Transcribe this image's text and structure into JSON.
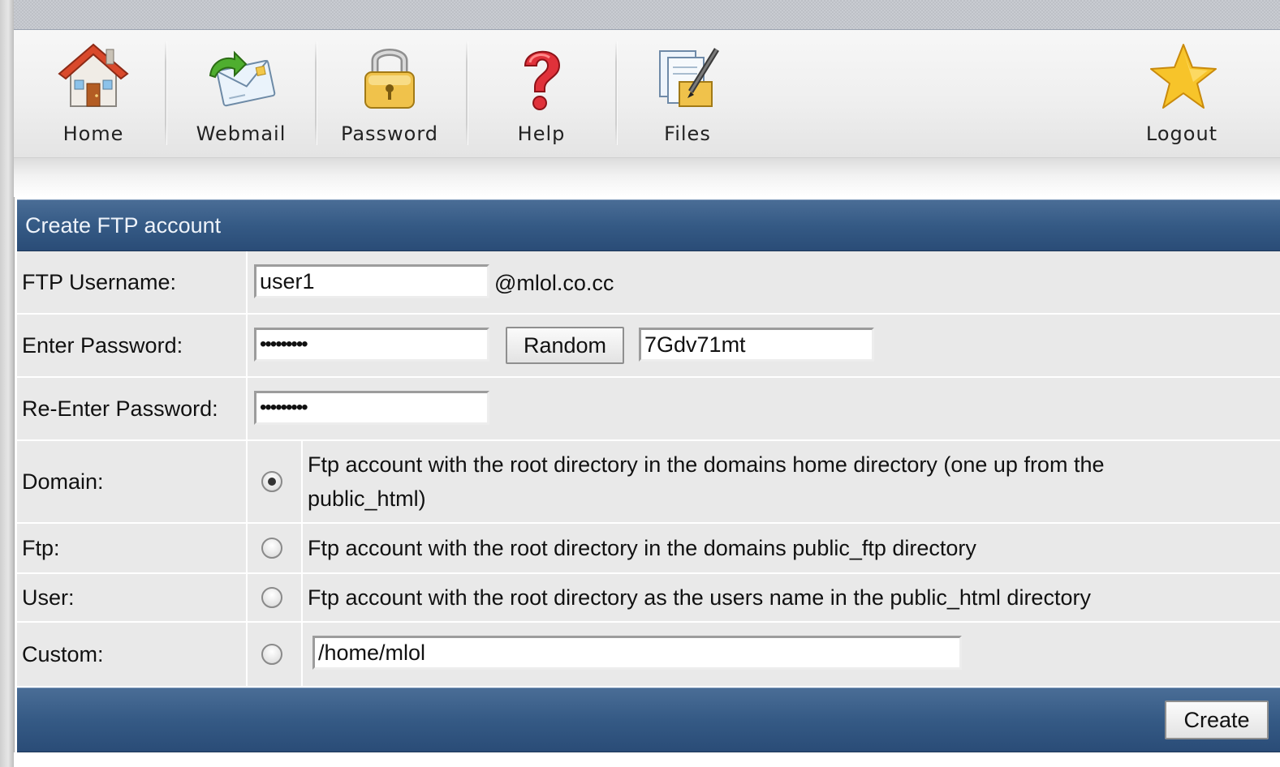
{
  "nav": {
    "items": [
      {
        "label": "Home",
        "icon": "home-icon"
      },
      {
        "label": "Webmail",
        "icon": "webmail-icon"
      },
      {
        "label": "Password",
        "icon": "padlock-icon"
      },
      {
        "label": "Help",
        "icon": "question-mark-icon"
      },
      {
        "label": "Files",
        "icon": "files-icon"
      },
      {
        "label": "Logout",
        "icon": "star-icon"
      }
    ]
  },
  "panel": {
    "title": "Create FTP account"
  },
  "form": {
    "username": {
      "label": "FTP Username:",
      "value": "user1",
      "domain_suffix": "@mlol.co.cc"
    },
    "password": {
      "label": "Enter Password:",
      "masked": "•••••••••",
      "random_button": "Random",
      "generated": "7Gdv71mt"
    },
    "reenter": {
      "label": "Re-Enter Password:",
      "masked": "•••••••••"
    },
    "options": [
      {
        "label": "Domain:",
        "text": "Ftp account with the root directory in the domains home directory (one up from the public_html)",
        "checked": true
      },
      {
        "label": "Ftp:",
        "text": "Ftp account with the root directory in the domains public_ftp directory",
        "checked": false
      },
      {
        "label": "User:",
        "text": "Ftp account with the root directory as the users name in the public_html directory",
        "checked": false
      },
      {
        "label": "Custom:",
        "path": "/home/mlol",
        "checked": false
      }
    ],
    "create_button": "Create"
  },
  "colors": {
    "header_blue": "#355a85",
    "form_bg": "#e9e9e9"
  }
}
